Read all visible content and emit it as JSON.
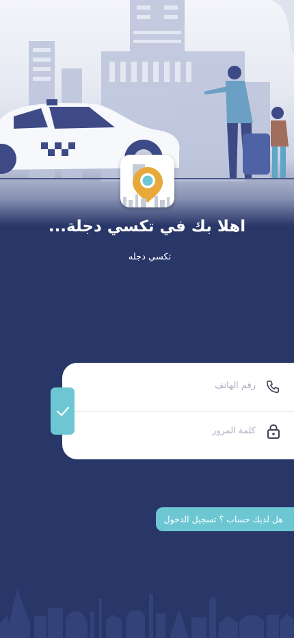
{
  "welcome_title": "اهلا بك في تكسي دجلة...",
  "subtitle": "تكسي دجله",
  "form": {
    "phone_placeholder": "رقم الهاتف",
    "password_placeholder": "كلمة المرور"
  },
  "register_link": "هل لديك حساب ؟ تسجيل الدخول",
  "icons": {
    "phone": "phone-icon",
    "password": "lock-icon",
    "submit": "check-icon"
  },
  "colors": {
    "background": "#283668",
    "accent": "#6cc7d3",
    "logo_pin": "#e7a93a"
  }
}
